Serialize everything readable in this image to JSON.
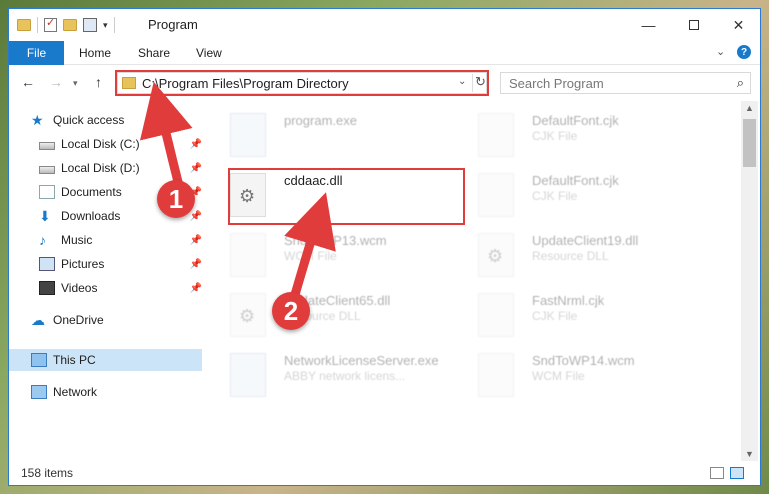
{
  "window": {
    "title": "Program"
  },
  "ribbon": {
    "file": "File",
    "home": "Home",
    "share": "Share",
    "view": "View"
  },
  "address": {
    "path": "C:\\Program Files\\Program Directory"
  },
  "search": {
    "placeholder": "Search Program"
  },
  "sidebar": {
    "items": [
      {
        "label": "Quick access",
        "icon": "star-icon"
      },
      {
        "label": "Local Disk (C:)",
        "icon": "drive-icon",
        "pinned": true
      },
      {
        "label": "Local Disk (D:)",
        "icon": "drive-icon",
        "pinned": true
      },
      {
        "label": "Documents",
        "icon": "documents-icon",
        "pinned": true
      },
      {
        "label": "Downloads",
        "icon": "download-icon",
        "pinned": true
      },
      {
        "label": "Music",
        "icon": "music-icon",
        "pinned": true
      },
      {
        "label": "Pictures",
        "icon": "pictures-icon",
        "pinned": true
      },
      {
        "label": "Videos",
        "icon": "videos-icon",
        "pinned": true
      },
      {
        "label": "OneDrive",
        "icon": "cloud-icon"
      },
      {
        "label": "This PC",
        "icon": "pc-icon",
        "selected": true
      },
      {
        "label": "Network",
        "icon": "network-icon"
      }
    ]
  },
  "files": [
    {
      "name": "program.exe",
      "type": ""
    },
    {
      "name": "DefaultFont.cjk",
      "type": "CJK File"
    },
    {
      "name": "cddaac.dll",
      "type": ""
    },
    {
      "name": "DefaultFont.cjk",
      "type": "CJK File"
    },
    {
      "name": "SndToWP13.wcm",
      "type": "WCM File"
    },
    {
      "name": "UpdateClient19.dll",
      "type": "Resource DLL"
    },
    {
      "name": "UpdateClient65.dll",
      "type": "Resource DLL"
    },
    {
      "name": "FastNrml.cjk",
      "type": "CJK File"
    },
    {
      "name": "NetworkLicenseServer.exe",
      "type": "ABBY network licens..."
    },
    {
      "name": "SndToWP14.wcm",
      "type": "WCM File"
    }
  ],
  "status": {
    "count": "158 items"
  },
  "annotations": {
    "step1": "1",
    "step2": "2"
  },
  "colors": {
    "accent": "#1979ca",
    "highlight": "#e03c3c",
    "selected": "#cce4f7"
  }
}
